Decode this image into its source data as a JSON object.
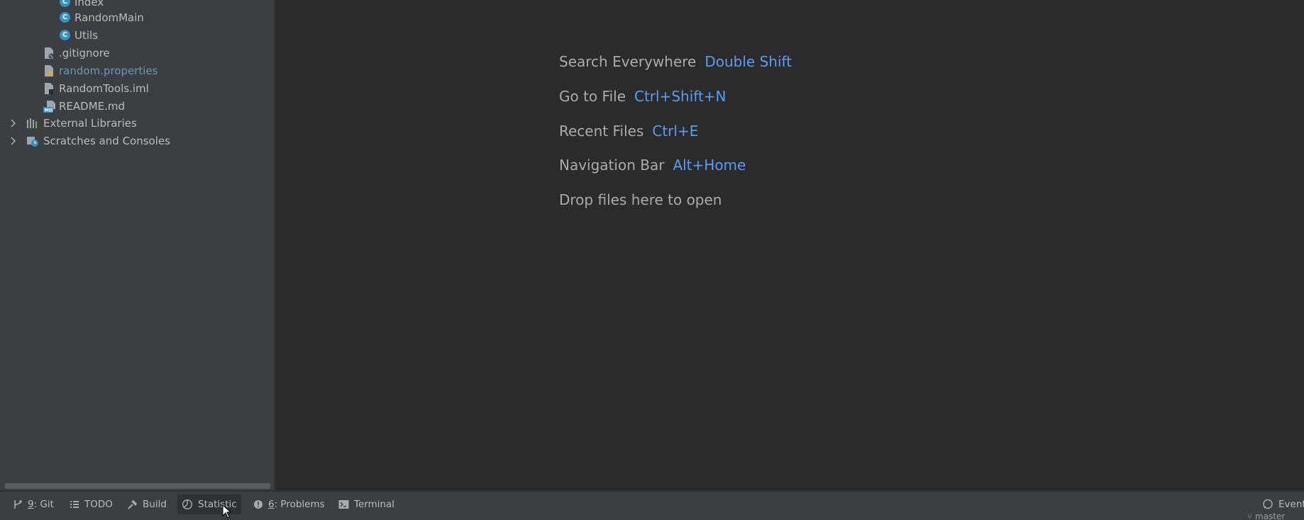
{
  "project_tree": {
    "items": [
      {
        "label": "Index",
        "icon": "java-class-icon"
      },
      {
        "label": "RandomMain",
        "icon": "java-class-icon"
      },
      {
        "label": "Utils",
        "icon": "java-class-icon"
      },
      {
        "label": ".gitignore",
        "icon": "gitignore-file-icon"
      },
      {
        "label": "random.properties",
        "icon": "properties-file-icon"
      },
      {
        "label": "RandomTools.iml",
        "icon": "iml-file-icon"
      },
      {
        "label": "README.md",
        "icon": "markdown-file-icon"
      },
      {
        "label": "External Libraries",
        "icon": "libraries-icon"
      },
      {
        "label": "Scratches and Consoles",
        "icon": "scratches-icon"
      }
    ]
  },
  "editor": {
    "hints": [
      {
        "text": "Search Everywhere",
        "shortcut": "Double Shift"
      },
      {
        "text": "Go to File",
        "shortcut": "Ctrl+Shift+N"
      },
      {
        "text": "Recent Files",
        "shortcut": "Ctrl+E"
      },
      {
        "text": "Navigation Bar",
        "shortcut": "Alt+Home"
      },
      {
        "text": "Drop files here to open",
        "shortcut": ""
      }
    ]
  },
  "toolbar": {
    "git": {
      "mnemonic": "9",
      "label": ": Git"
    },
    "todo": {
      "label": "TODO"
    },
    "build": {
      "label": "Build"
    },
    "statistic": {
      "label": "Statistic"
    },
    "problems": {
      "mnemonic": "6",
      "label": ": Problems"
    },
    "terminal": {
      "label": "Terminal"
    },
    "event": {
      "label": "Event"
    }
  },
  "status": {
    "branch": "master"
  },
  "colors": {
    "editor_bg": "#2b2b2b",
    "panel_bg": "#3c3f41",
    "shortcut": "#589df6",
    "modified_file": "#6897bb",
    "class_icon": "#3592c4"
  }
}
